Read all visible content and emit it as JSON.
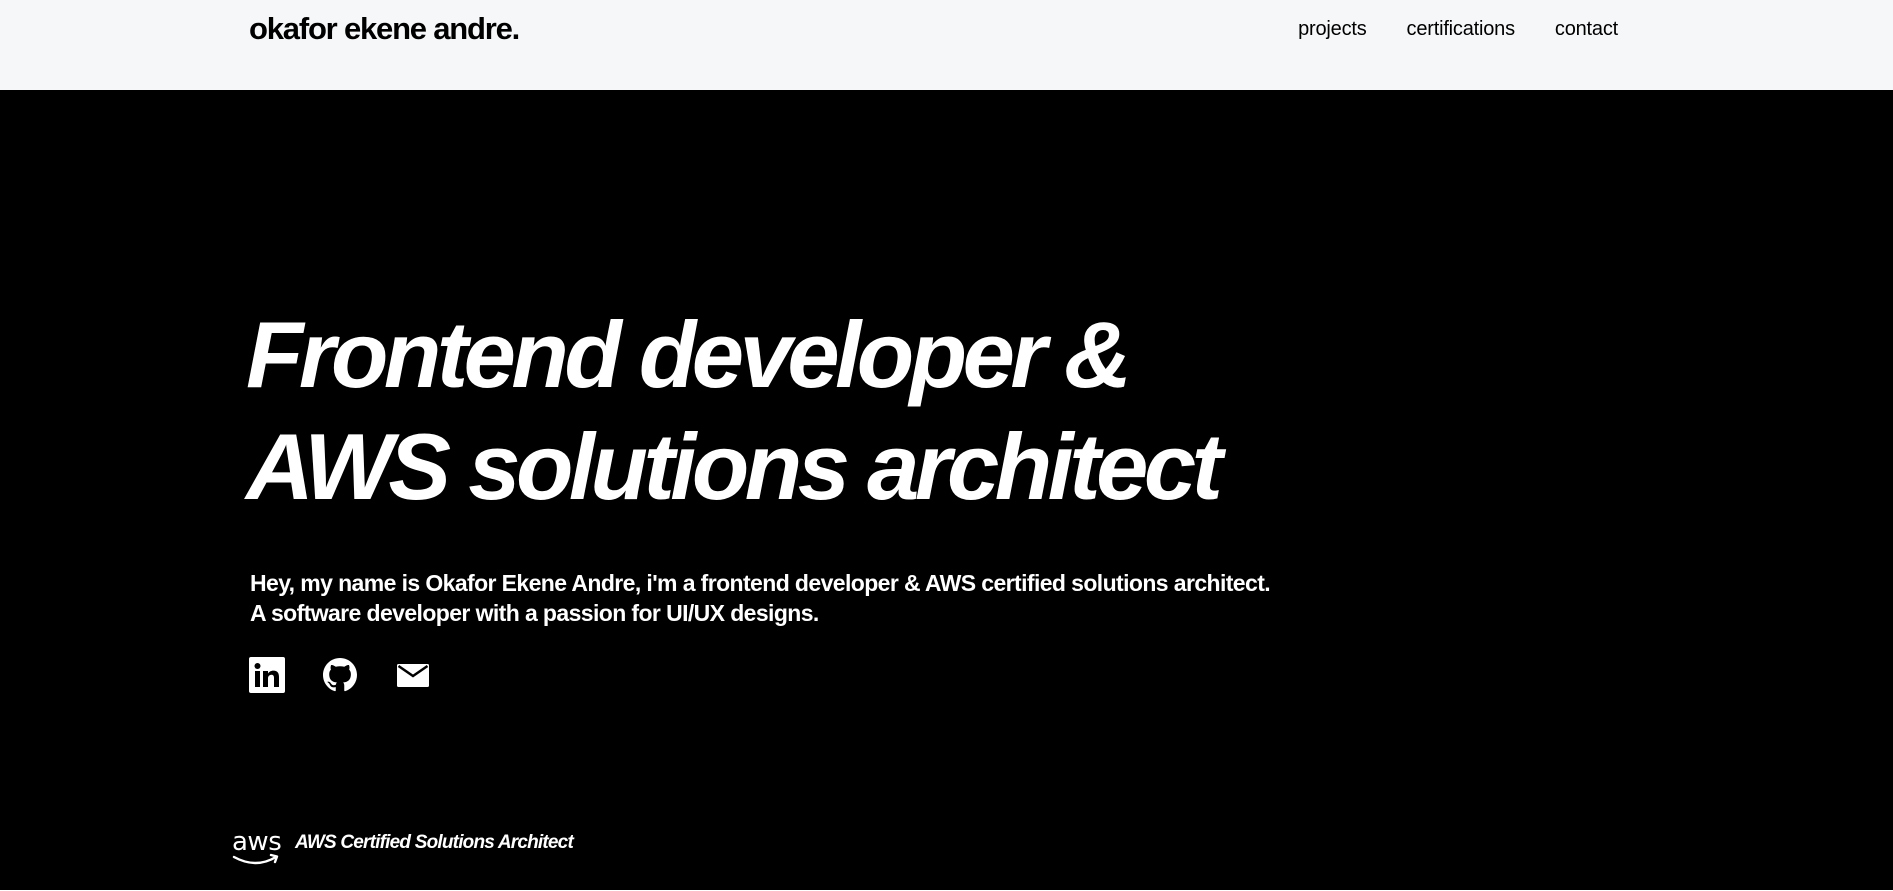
{
  "header": {
    "brand": "okafor ekene andre.",
    "nav": [
      {
        "label": "projects"
      },
      {
        "label": "certifications"
      },
      {
        "label": "contact"
      }
    ]
  },
  "hero": {
    "headline_line1": "Frontend developer &",
    "headline_line2": "AWS solutions architect",
    "intro_line1": "Hey, my name is Okafor Ekene Andre, i'm a frontend developer & AWS certified solutions architect.",
    "intro_line2": "A software developer with a passion for UI/UX designs.",
    "socials": [
      {
        "icon": "linkedin-icon"
      },
      {
        "icon": "github-icon"
      },
      {
        "icon": "mail-icon"
      }
    ],
    "badge": {
      "logo_text": "aws",
      "label": "AWS Certified Solutions Architect"
    }
  },
  "colors": {
    "header_bg": "#f6f7f9",
    "hero_bg": "#000000",
    "text_dark": "#000000",
    "text_light": "#ffffff"
  }
}
